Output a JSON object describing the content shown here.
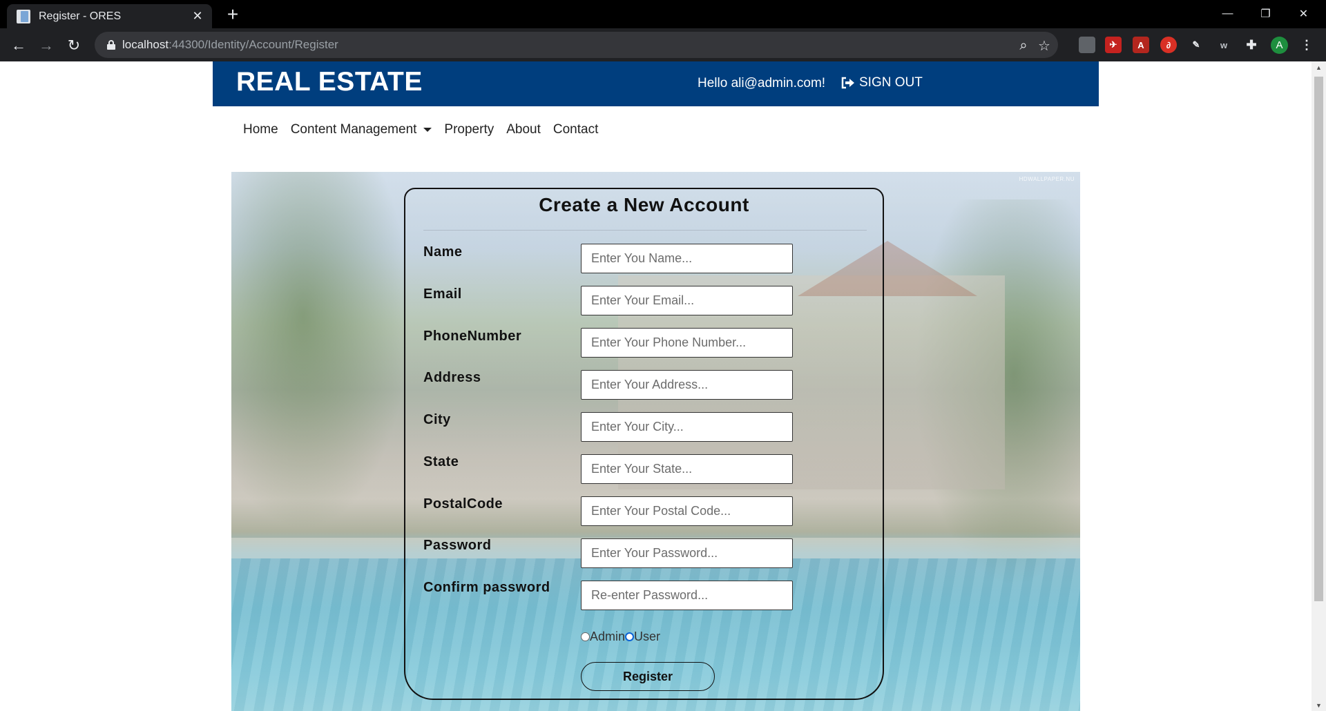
{
  "browser": {
    "tab_title": "Register - ORES",
    "url_host": "localhost",
    "url_path": ":44300/Identity/Account/Register",
    "profile_initial": "A"
  },
  "header": {
    "site_title": "REAL ESTATE",
    "greeting": "Hello ali@admin.com!",
    "signout_label": "SIGN OUT"
  },
  "nav": {
    "home": "Home",
    "content_management": "Content Management",
    "property": "Property",
    "about": "About",
    "contact": "Contact"
  },
  "hero": {
    "watermark": "HDWALLPAPER.NU"
  },
  "form": {
    "title": "Create a New Account",
    "fields": [
      {
        "label": "Name",
        "placeholder": "Enter You Name..."
      },
      {
        "label": "Email",
        "placeholder": "Enter Your Email..."
      },
      {
        "label": "PhoneNumber",
        "placeholder": "Enter Your Phone Number..."
      },
      {
        "label": "Address",
        "placeholder": "Enter Your Address..."
      },
      {
        "label": "City",
        "placeholder": "Enter Your City..."
      },
      {
        "label": "State",
        "placeholder": "Enter Your State..."
      },
      {
        "label": "PostalCode",
        "placeholder": "Enter Your Postal Code..."
      },
      {
        "label": "Password",
        "placeholder": "Enter Your Password..."
      },
      {
        "label": "Confirm password",
        "placeholder": "Re-enter Password..."
      }
    ],
    "role_admin": "Admin",
    "role_user": "User",
    "selected_role": "User",
    "register_label": "Register"
  },
  "colors": {
    "header_bg": "#003e7e",
    "radio_selected": "#0b63d6"
  }
}
